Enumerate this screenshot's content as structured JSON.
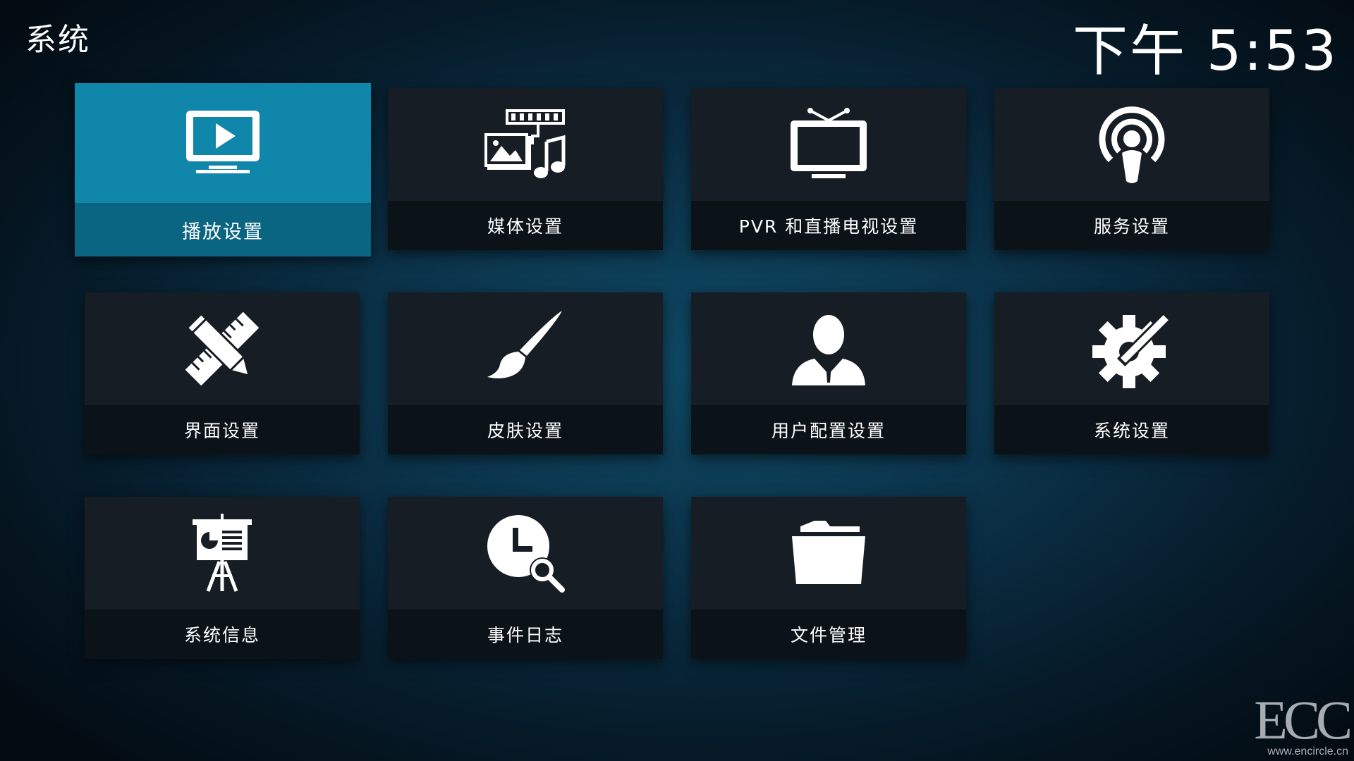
{
  "header": {
    "title": "系统",
    "clock": "下午 5:53"
  },
  "tiles": [
    {
      "label": "播放设置",
      "icon": "tv-play-icon",
      "focused": true
    },
    {
      "label": "媒体设置",
      "icon": "media-icon"
    },
    {
      "label": "PVR 和直播电视设置",
      "icon": "tv-antenna-icon"
    },
    {
      "label": "服务设置",
      "icon": "podcast-icon"
    },
    {
      "label": "界面设置",
      "icon": "pencil-ruler-icon"
    },
    {
      "label": "皮肤设置",
      "icon": "paintbrush-icon"
    },
    {
      "label": "用户配置设置",
      "icon": "user-profile-icon"
    },
    {
      "label": "系统设置",
      "icon": "gear-wrench-icon"
    },
    {
      "label": "系统信息",
      "icon": "presentation-board-icon"
    },
    {
      "label": "事件日志",
      "icon": "clock-search-icon"
    },
    {
      "label": "文件管理",
      "icon": "folder-icon"
    }
  ],
  "watermark": {
    "logo": "ECC",
    "url": "www.encircle.cn"
  },
  "colors": {
    "focus": "#0d7ea2",
    "tile": "#111920",
    "text": "#ffffff"
  }
}
